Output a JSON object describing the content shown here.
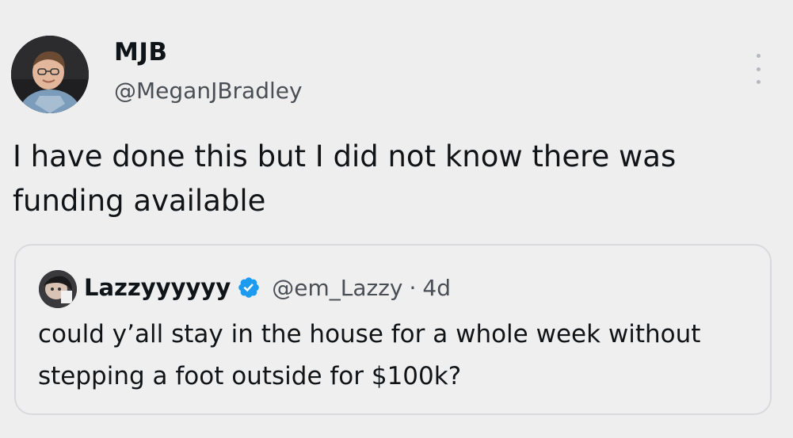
{
  "tweet": {
    "author": {
      "display_name": "MJB",
      "handle": "@MeganJBradley",
      "avatar_icon": "user-avatar"
    },
    "text": "I have done this but I did not know there was funding available",
    "menu_icon": "more-vertical-icon"
  },
  "quoted_tweet": {
    "author": {
      "display_name": "Lazzyyyyyy",
      "handle": "@em_Lazzy",
      "verified": true,
      "verified_color": "#1d9bf0"
    },
    "separator": "·",
    "time": "4d",
    "text": "could y’all stay in the house for a whole week without stepping a foot outside for $100k?"
  },
  "colors": {
    "background": "#eeeeef",
    "text_primary": "#0f1419",
    "text_secondary": "#4a4f55",
    "border": "#d7d9dc"
  }
}
